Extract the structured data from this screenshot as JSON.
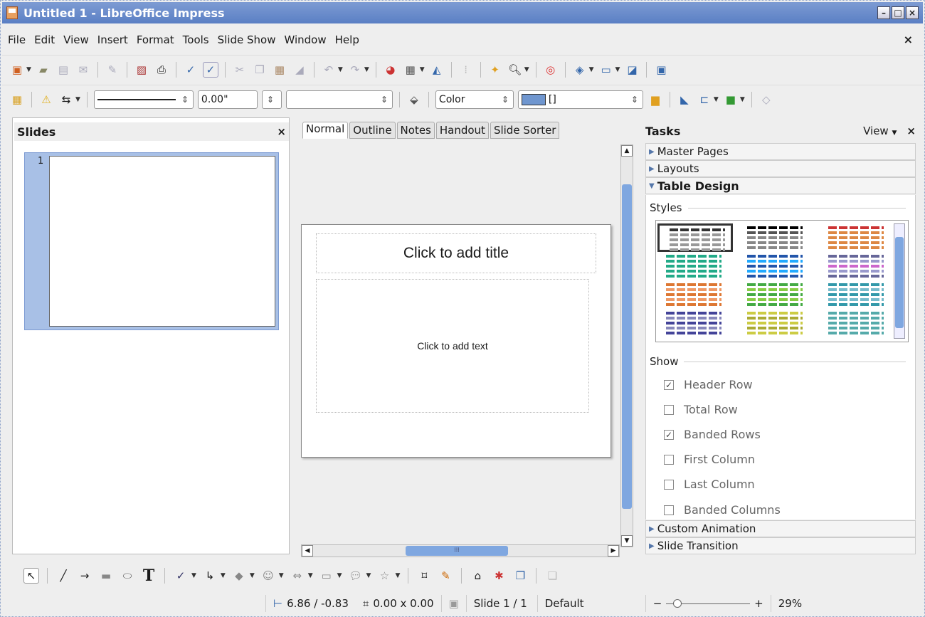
{
  "window": {
    "title": "Untitled 1 - LibreOffice Impress",
    "min": "–",
    "max": "□",
    "close": "×"
  },
  "menu": {
    "items": [
      "File",
      "Edit",
      "View",
      "Insert",
      "Format",
      "Tools",
      "Slide Show",
      "Window",
      "Help"
    ],
    "close": "×"
  },
  "toolbar2": {
    "line_width": "0.00\"",
    "area_style": "Color",
    "area_fill": "[]"
  },
  "slides_pane": {
    "title": "Slides",
    "close": "×",
    "slide_number": "1"
  },
  "view_tabs": [
    "Normal",
    "Outline",
    "Notes",
    "Handout",
    "Slide Sorter"
  ],
  "slide": {
    "title_placeholder": "Click to add title",
    "text_placeholder": "Click to add text"
  },
  "tasks": {
    "title": "Tasks",
    "view_label": "View",
    "close": "×",
    "sections": {
      "master_pages": "Master Pages",
      "layouts": "Layouts",
      "table_design": "Table Design",
      "custom_animation": "Custom Animation",
      "slide_transition": "Slide Transition"
    },
    "styles_label": "Styles",
    "show_label": "Show",
    "options": [
      {
        "label": "Header Row",
        "checked": true
      },
      {
        "label": "Total Row",
        "checked": false
      },
      {
        "label": "Banded Rows",
        "checked": true
      },
      {
        "label": "First Column",
        "checked": false
      },
      {
        "label": "Last Column",
        "checked": false
      },
      {
        "label": "Banded Columns",
        "checked": false
      }
    ]
  },
  "status": {
    "position": "6.86 / -0.83",
    "size": "0.00 x 0.00",
    "slide": "Slide 1 / 1",
    "master": "Default",
    "zoom": "29%"
  },
  "colors": {
    "accent": "#7d9bd3",
    "scroll_thumb": "#7fa7e0"
  }
}
